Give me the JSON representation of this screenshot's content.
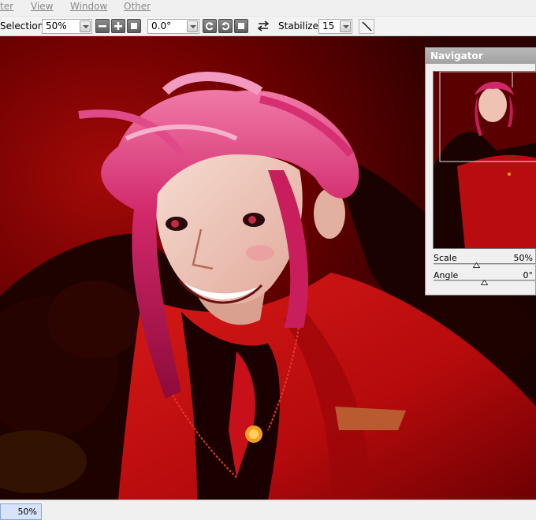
{
  "menubar": {
    "items": [
      {
        "label": "ter"
      },
      {
        "label": "View"
      },
      {
        "label": "Window"
      },
      {
        "label": "Other"
      }
    ]
  },
  "toolbar": {
    "selection_label": "Selection",
    "zoom_value": "50%",
    "angle_value": "0.0°",
    "stabilizer_label": "Stabilizer",
    "stabilizer_value": "15"
  },
  "navigator": {
    "title": "Navigator",
    "scale_label": "Scale",
    "scale_value": "50%",
    "scale_fraction": 0.5,
    "angle_label": "Angle",
    "angle_value": "0°"
  },
  "statusbar": {
    "zoom": "50%"
  },
  "colors": {
    "canvas_bg": "#3a0000",
    "hair": "#d0205e",
    "jacket": "#b80c10",
    "skin": "#f0c8b8"
  },
  "icons": [
    "zoom-out-icon",
    "zoom-in-icon",
    "zoom-reset-icon",
    "rotate-ccw-icon",
    "rotate-cw-icon",
    "rotate-reset-icon",
    "flip-horizontal-icon",
    "line-tool-icon"
  ]
}
